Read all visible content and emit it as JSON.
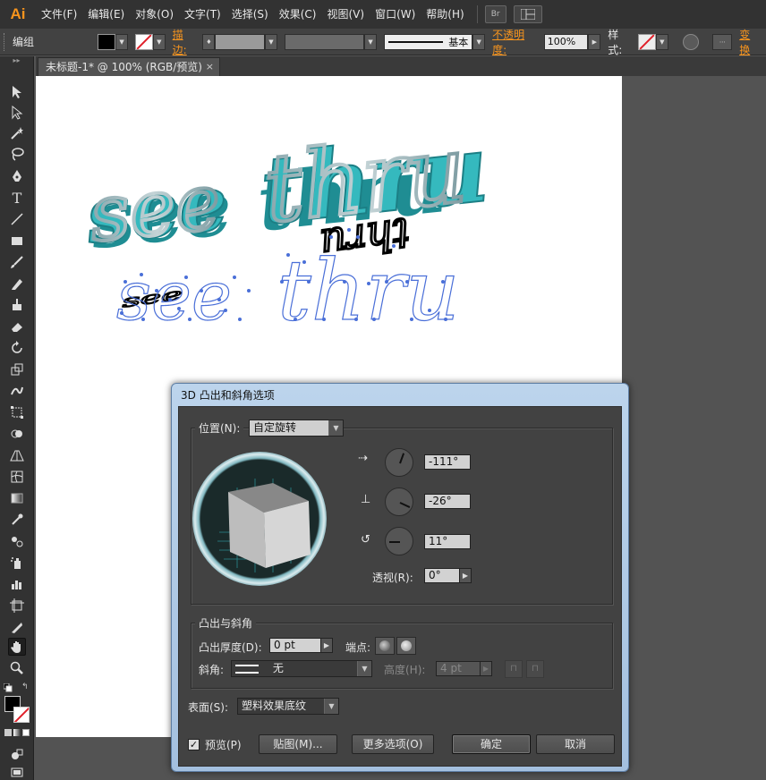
{
  "app": {
    "logo": "Ai"
  },
  "menu": {
    "items": [
      "文件(F)",
      "编辑(E)",
      "对象(O)",
      "文字(T)",
      "选择(S)",
      "效果(C)",
      "视图(V)",
      "窗口(W)",
      "帮助(H)"
    ],
    "bridge_label": "Br"
  },
  "control_bar": {
    "selection_label": "编组",
    "stroke_label": "描边:",
    "stroke_style_label": "基本",
    "opacity_label": "不透明度:",
    "opacity_value": "100%",
    "style_label": "样式:",
    "transform_label": "变换"
  },
  "document": {
    "tab_title": "未标题-1* @ 100% (RGB/预览)",
    "tab_close": "×"
  },
  "artwork": {
    "text_3d": "see thru",
    "text_outline": "see thru",
    "text_rotated": "see thru"
  },
  "dialog": {
    "title": "3D 凸出和斜角选项",
    "position": {
      "label": "位置(N):",
      "value": "自定旋转"
    },
    "rotation": {
      "x": "-111°",
      "y": "-26°",
      "z": "11°"
    },
    "perspective": {
      "label": "透视(R):",
      "value": "0°"
    },
    "extrude_group": "凸出与斜角",
    "extrude_depth": {
      "label": "凸出厚度(D):",
      "value": "0 pt"
    },
    "cap_label": "端点:",
    "bevel": {
      "label": "斜角:",
      "value": "无"
    },
    "height": {
      "label": "高度(H):",
      "value": "4 pt"
    },
    "surface": {
      "label": "表面(S):",
      "value": "塑料效果底纹"
    },
    "preview_label": "预览(P)",
    "preview_checked": "✓",
    "map_button": "贴图(M)...",
    "more_options_button": "更多选项(O)",
    "ok_button": "确定",
    "cancel_button": "取消"
  },
  "colors": {
    "accent": "#f7941d",
    "extrude_teal": "#2fb3b8",
    "selection_blue": "#4a6fd8",
    "dialog_chrome": "#a9c3e0"
  }
}
